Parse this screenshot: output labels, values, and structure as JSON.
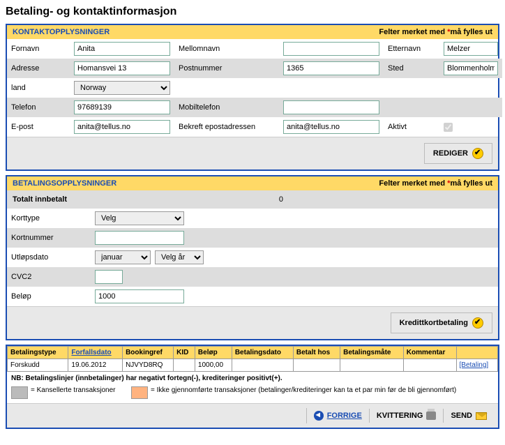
{
  "page_title": "Betaling- og kontaktinformasjon",
  "required_note": {
    "prefix": "Felter merket med ",
    "star": "*",
    "suffix": "må fylles ut"
  },
  "contact": {
    "header": "KONTAKTOPPLYSNINGER",
    "labels": {
      "fornavn": "Fornavn",
      "mellomnavn": "Mellomnavn",
      "etternavn": "Etternavn",
      "adresse": "Adresse",
      "postnummer": "Postnummer",
      "sted": "Sted",
      "land": "land",
      "telefon": "Telefon",
      "mobil": "Mobiltelefon",
      "epost": "E-post",
      "bekreft": "Bekreft epostadressen",
      "aktivt": "Aktivt"
    },
    "values": {
      "fornavn": "Anita",
      "mellomnavn": "",
      "etternavn": "Melzer",
      "adresse": "Homansvei 13",
      "postnummer": "1365",
      "sted": "Blommenholm",
      "land": "Norway",
      "telefon": "97689139",
      "mobil": "",
      "epost": "anita@tellus.no",
      "bekreft": "anita@tellus.no"
    },
    "edit_button": "REDIGER"
  },
  "payment": {
    "header": "BETALINGSOPPLYSNINGER",
    "labels": {
      "total": "Totalt innbetalt",
      "korttype": "Korttype",
      "kortnummer": "Kortnummer",
      "utlop": "Utløpsdato",
      "cvc": "CVC2",
      "belop": "Beløp"
    },
    "values": {
      "total": "0",
      "korttype": "Velg",
      "kortnummer": "",
      "maned": "januar",
      "ar": "Velg år",
      "cvc": "",
      "belop": "1000"
    },
    "cc_button": "Kredittkortbetaling"
  },
  "table": {
    "headers": {
      "type": "Betalingstype",
      "forfall": "Forfallsdato",
      "booking": "Bookingref",
      "kid": "KID",
      "belop": "Beløp",
      "betdato": "Betalingsdato",
      "hos": "Betalt hos",
      "mate": "Betalingsmåte",
      "komm": "Kommentar",
      "act": ""
    },
    "row": {
      "type": "Forskudd",
      "forfall": "19.06.2012",
      "booking": "NJVYD8RQ",
      "kid": "",
      "belop": "1000,00",
      "betdato": "",
      "hos": "",
      "mate": "",
      "komm": "",
      "link": "[Betaling]"
    }
  },
  "note": "NB: Betalingslinjer (innbetalinger) har negativt fortegn(-), krediteringer positivt(+).",
  "legend": {
    "cancelled": "= Kansellerte transaksjoner",
    "pending": "= Ikke gjennomførte transaksjoner (betalinger/krediteringer kan ta et par min før de bli gjennomført)"
  },
  "footer": {
    "forrige": "FORRIGE",
    "kvittering": "KVITTERING",
    "send": "SEND"
  }
}
